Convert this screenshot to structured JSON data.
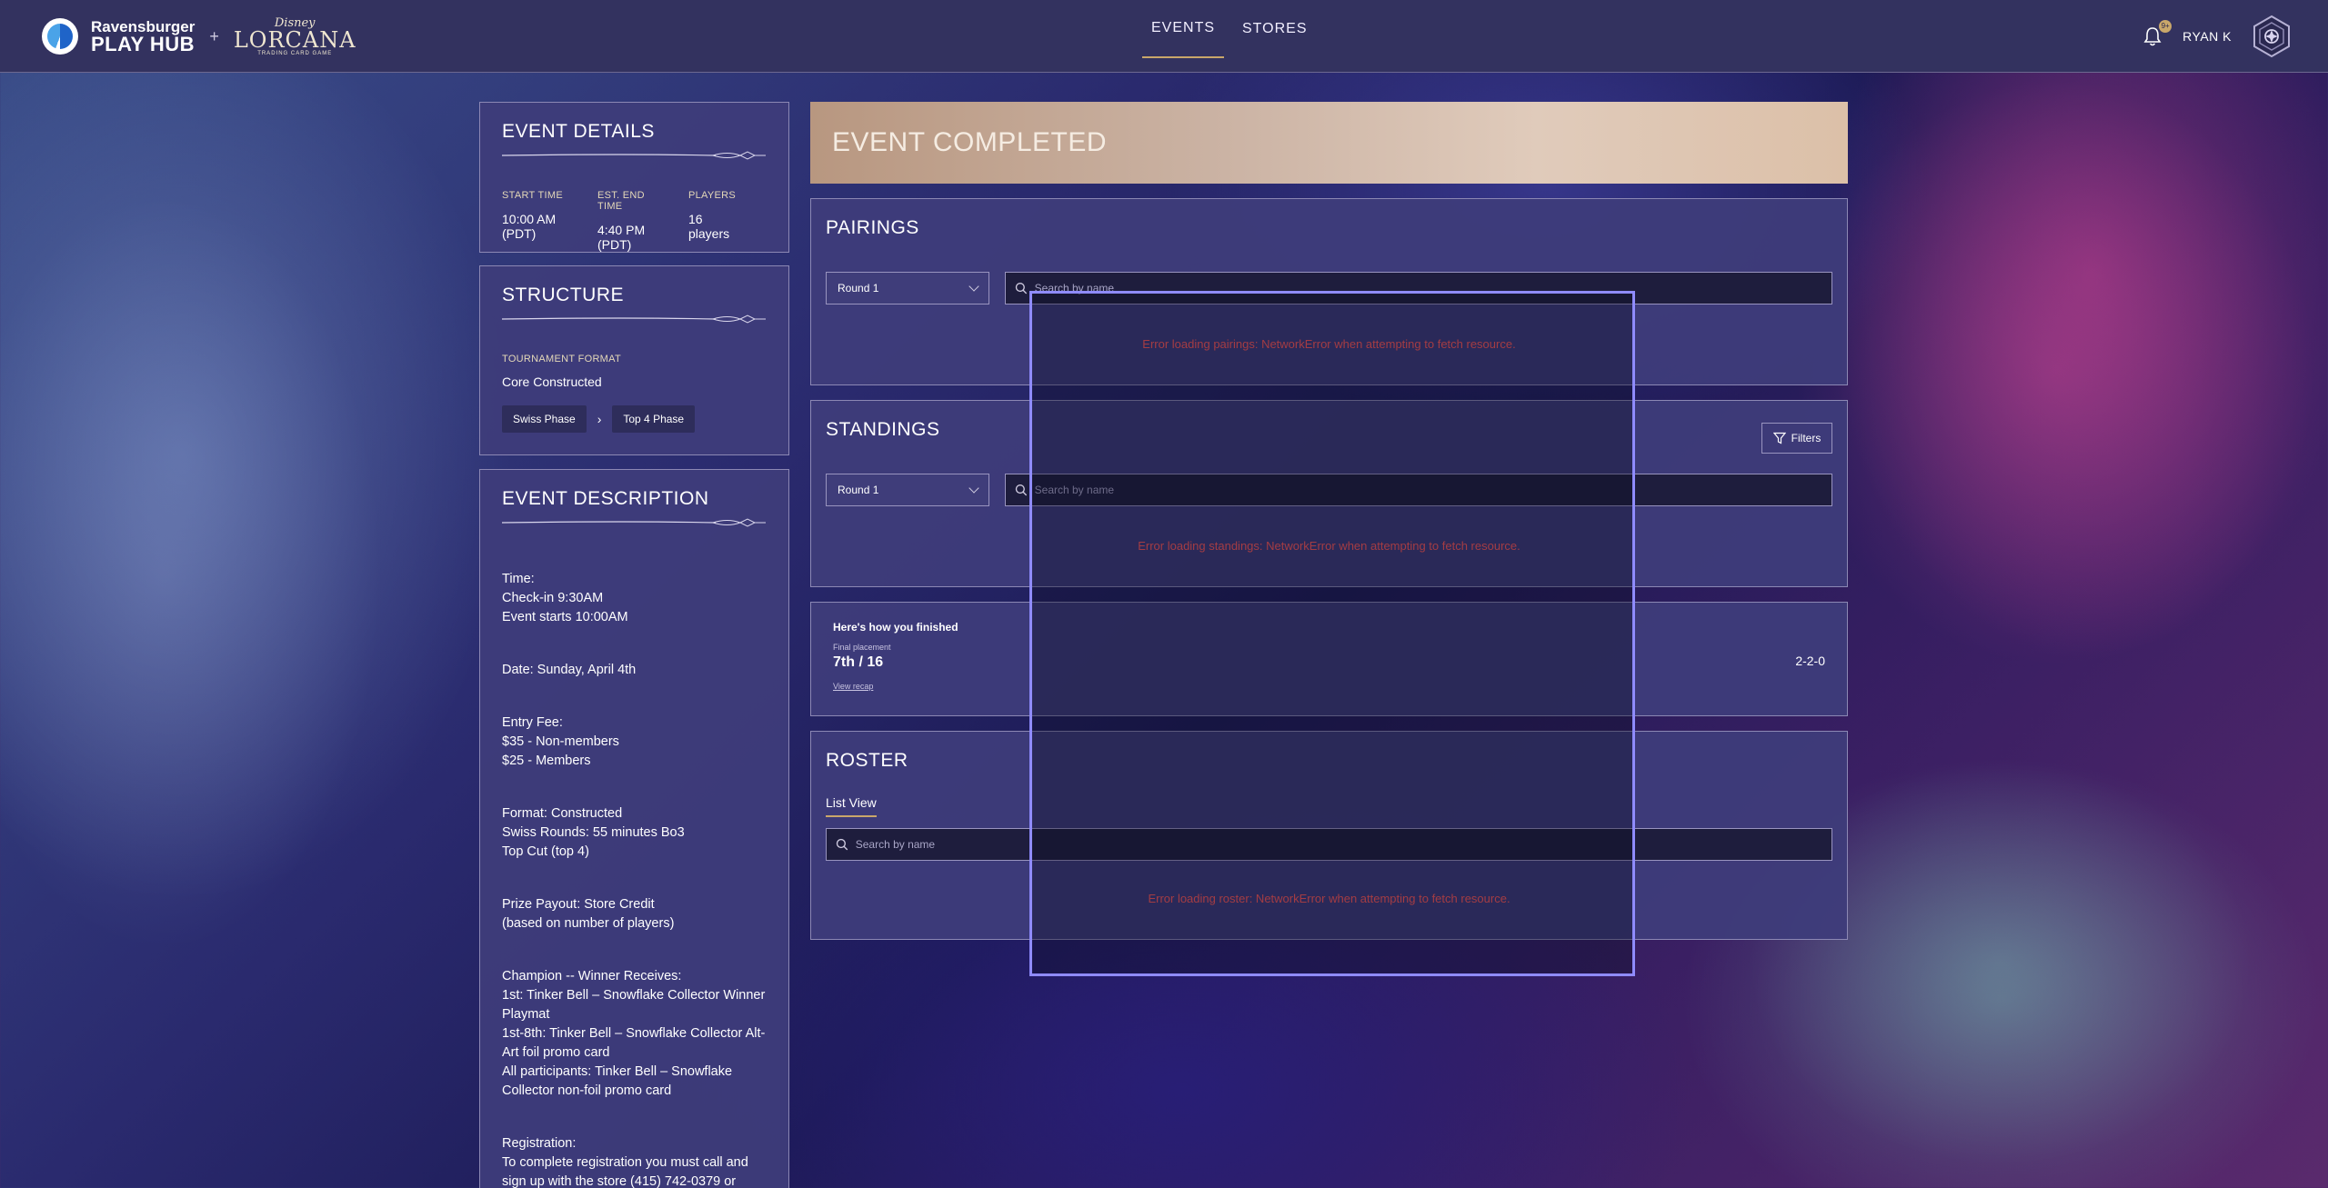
{
  "brand": {
    "ravensburger_top": "Ravensburger",
    "ravensburger_bottom": "PLAY HUB",
    "plus": "+",
    "disney": "Disney",
    "lorcana": "LORCANA",
    "lorcana_sub": "TRADING CARD GAME"
  },
  "nav": {
    "items": [
      {
        "label": "EVENTS",
        "active": true
      },
      {
        "label": "STORES",
        "active": false
      }
    ]
  },
  "user": {
    "notification_badge": "9+",
    "name": "RYAN K",
    "avatar_icon": "hexagon-avatar-icon"
  },
  "event_details": {
    "title": "EVENT DETAILS",
    "fields": [
      {
        "label": "START TIME",
        "value": "10:00 AM (PDT)"
      },
      {
        "label": "EST. END TIME",
        "value": "4:40 PM (PDT)"
      },
      {
        "label": "PLAYERS",
        "value": "16 players"
      }
    ]
  },
  "structure": {
    "title": "STRUCTURE",
    "format_label": "TOURNAMENT FORMAT",
    "format_value": "Core Constructed",
    "phases": [
      "Swiss Phase",
      "Top 4 Phase"
    ]
  },
  "description": {
    "title": "EVENT DESCRIPTION",
    "blocks": [
      [
        "Time:",
        "Check-in 9:30AM",
        "Event starts 10:00AM"
      ],
      [
        "Date: Sunday, April 4th"
      ],
      [
        "Entry Fee:",
        "$35 - Non-members",
        "$25 - Members"
      ],
      [
        "Format: Constructed",
        "Swiss Rounds: 55 minutes Bo3",
        "Top Cut (top 4)"
      ],
      [
        "Prize Payout: Store Credit",
        "(based on number of players)"
      ],
      [
        "Champion -- Winner Receives:",
        "1st: Tinker Bell – Snowflake Collector Winner",
        "Playmat",
        "1st-8th: Tinker Bell – Snowflake Collector Alt-",
        "Art foil promo card",
        "All participants: Tinker Bell – Snowflake",
        "Collector non-foil promo card"
      ],
      [
        "Registration:",
        "To complete registration you must call and",
        "sign up with the store (415) 742-0379 or"
      ]
    ]
  },
  "banner": {
    "title": "EVENT COMPLETED"
  },
  "pairings": {
    "title": "PAIRINGS",
    "round": "Round 1",
    "search_placeholder": "Search by name",
    "error": "Error loading pairings: NetworkError when attempting to fetch resource."
  },
  "standings": {
    "title": "STANDINGS",
    "filters_label": "Filters",
    "round": "Round 1",
    "search_placeholder": "Search by name",
    "error": "Error loading standings: NetworkError when attempting to fetch resource."
  },
  "finish": {
    "title": "Here's how you finished",
    "placement_label": "Final placement",
    "placement_value": "7th / 16",
    "recap_link": "View recap",
    "record": "2-2-0"
  },
  "roster": {
    "title": "ROSTER",
    "tab": "List View",
    "search_placeholder": "Search by name",
    "error": "Error loading roster: NetworkError when attempting to fetch resource."
  },
  "colors": {
    "accent_gold": "#c9a76a",
    "panel_bg": "#3e3c7a",
    "error_red": "#ff5a56",
    "overlay_border": "#8f8bff"
  }
}
